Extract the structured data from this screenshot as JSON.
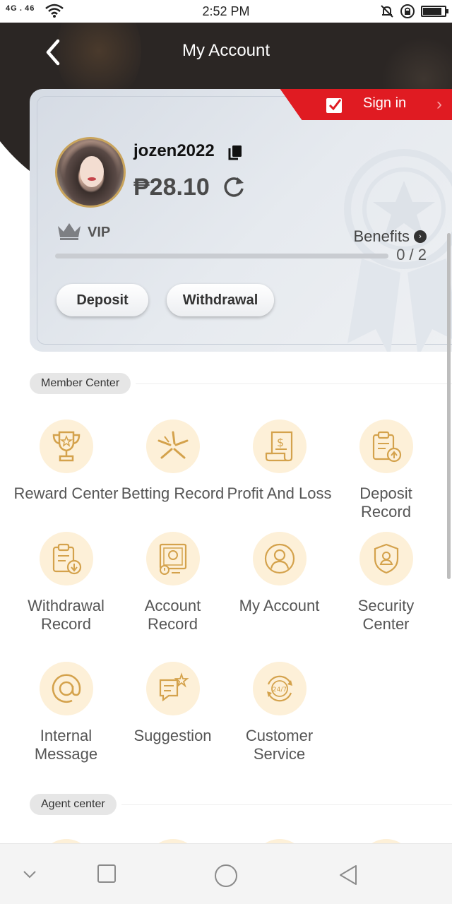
{
  "status_bar": {
    "signal": "4G . 46",
    "time": "2:52 PM"
  },
  "header": {
    "title": "My Account"
  },
  "account": {
    "sign_in_label": "Sign in",
    "username": "jozen2022",
    "balance": "₱28.10",
    "vip_label": "VIP",
    "benefits_label": "Benefits",
    "progress_count": "0 / 2",
    "progress_fraction": 0.0,
    "deposit_label": "Deposit",
    "withdrawal_label": "Withdrawal"
  },
  "member_center": {
    "title": "Member Center",
    "items": [
      {
        "label": "Reward Center",
        "icon": "trophy-icon"
      },
      {
        "label": "Betting Record",
        "icon": "betting-star-icon"
      },
      {
        "label": "Profit And Loss",
        "icon": "receipt-dollar-icon"
      },
      {
        "label": "Deposit Record",
        "icon": "clipboard-upload-icon"
      },
      {
        "label": "Withdrawal\nRecord",
        "icon": "clipboard-download-icon"
      },
      {
        "label": "Account\nRecord",
        "icon": "account-record-icon"
      },
      {
        "label": "My Account",
        "icon": "user-icon"
      },
      {
        "label": "Security Center",
        "icon": "shield-user-icon"
      },
      {
        "label": "Internal\nMessage",
        "icon": "at-sign-icon"
      },
      {
        "label": "Suggestion",
        "icon": "chat-star-icon"
      },
      {
        "label": "Customer\nService",
        "icon": "support-24-7-icon"
      }
    ]
  },
  "agent_center": {
    "title": "Agent center"
  },
  "colors": {
    "header_bg": "#2b2624",
    "sign_in_red": "#e01b22",
    "icon_bg": "#fdf0d8",
    "icon_gold": "#d4a24c"
  }
}
